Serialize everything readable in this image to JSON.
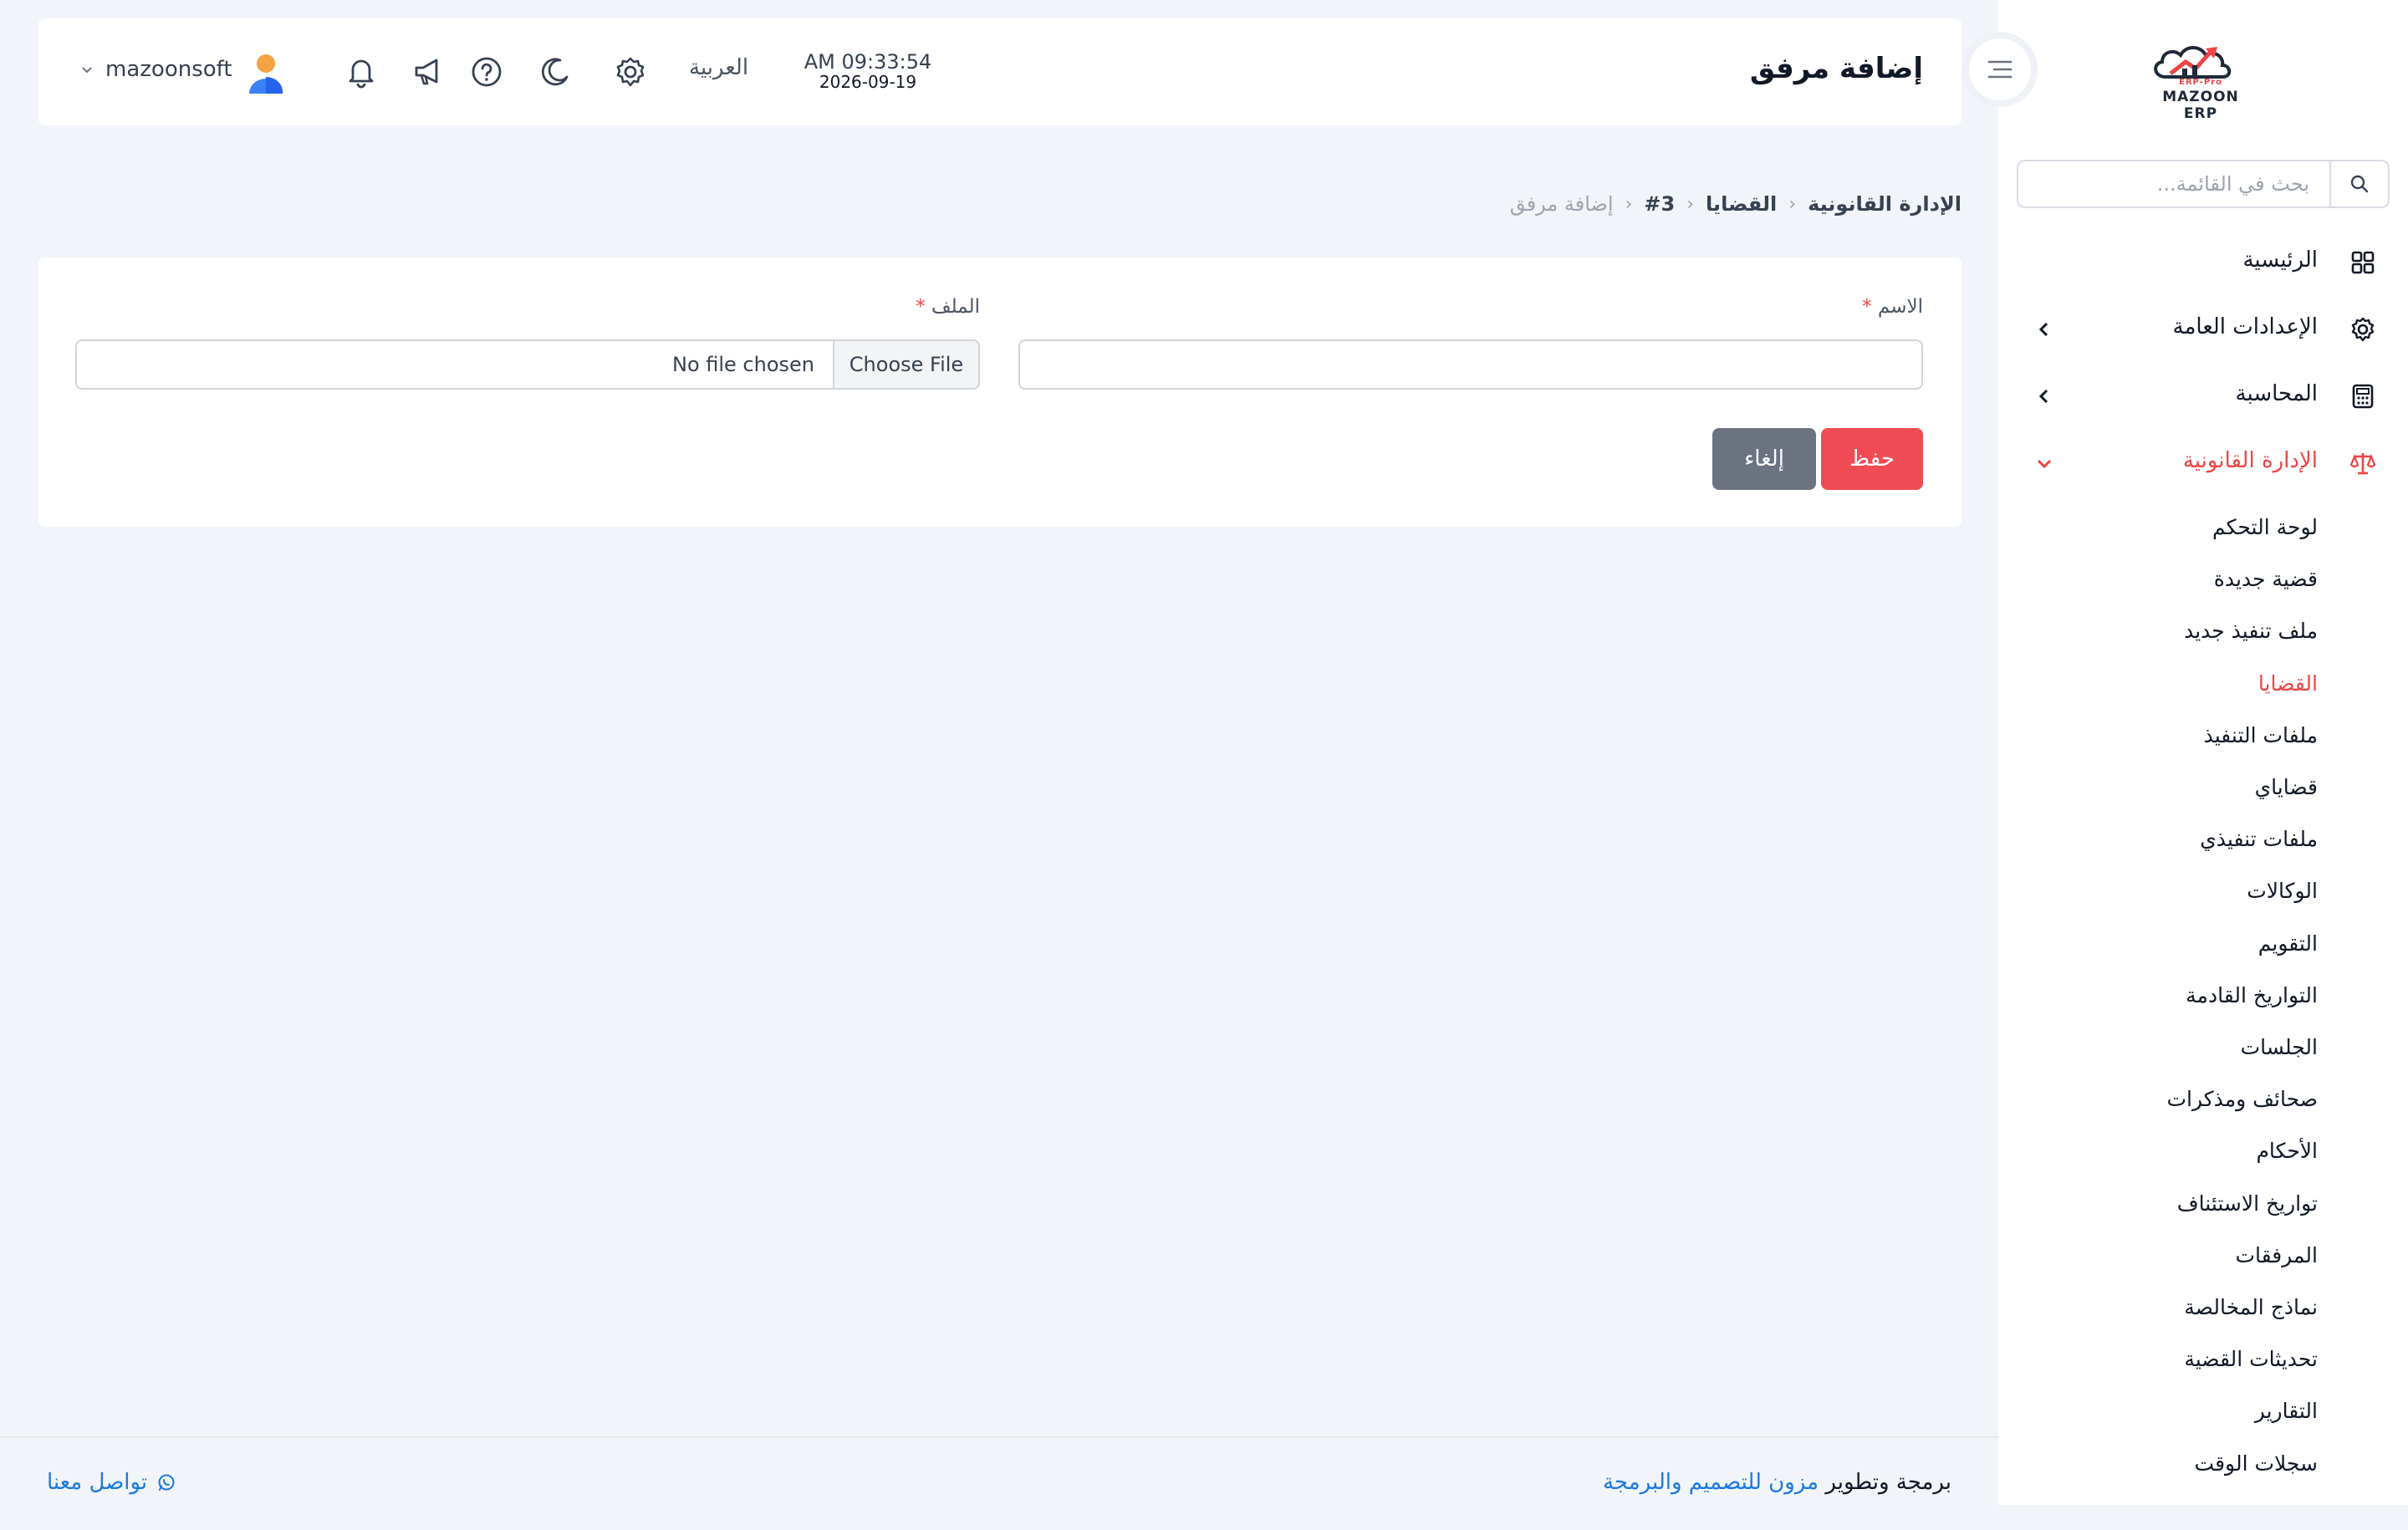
{
  "app": {
    "logo_text": "MAZOON ERP",
    "logo_tag": "ERP-Pro"
  },
  "sidebar": {
    "search_placeholder": "بحث في القائمة...",
    "items": [
      {
        "label": "الرئيسية",
        "icon": "grid-icon"
      },
      {
        "label": "الإعدادات العامة",
        "icon": "gear-icon"
      },
      {
        "label": "المحاسبة",
        "icon": "calculator-icon"
      },
      {
        "label": "الإدارة القانونية",
        "icon": "scale-icon"
      }
    ],
    "legal_sub_items": [
      "لوحة التحكم",
      "قضية جديدة",
      "ملف تنفيذ جديد",
      "القضايا",
      "ملفات التنفيذ",
      "قضاياي",
      "ملفات تنفيذي",
      "الوكالات",
      "التقويم",
      "التواريخ القادمة",
      "الجلسات",
      "صحائف ومذكرات",
      "الأحكام",
      "تواريخ الاستئناف",
      "المرفقات",
      "نماذج المخالصة",
      "تحديثات القضية",
      "التقارير",
      "سجلات الوقت"
    ],
    "active_sub_item": "القضايا"
  },
  "header": {
    "page_title": "إضافة مرفق",
    "time": "AM 09:33:54",
    "date": "2026-09-19",
    "language": "العربية",
    "username": "mazoonsoft"
  },
  "breadcrumb": {
    "items": [
      "الإدارة القانونية",
      "القضايا",
      "#3"
    ],
    "current": "إضافة مرفق"
  },
  "form": {
    "name_label": "الاسم",
    "file_label": "الملف",
    "required_mark": "*",
    "name_value": "",
    "file_button": "Choose File",
    "file_status": "No file chosen",
    "save_label": "حفظ",
    "cancel_label": "إلغاء"
  },
  "footer": {
    "credit_prefix": "برمجة وتطوير",
    "credit_link": "مزون للتصميم والبرمجة",
    "contact_label": "تواصل معنا"
  },
  "colors": {
    "accent": "#ef4444",
    "link": "#1d7ae0",
    "cancel": "#6b7280",
    "background": "#f1f4f8"
  }
}
